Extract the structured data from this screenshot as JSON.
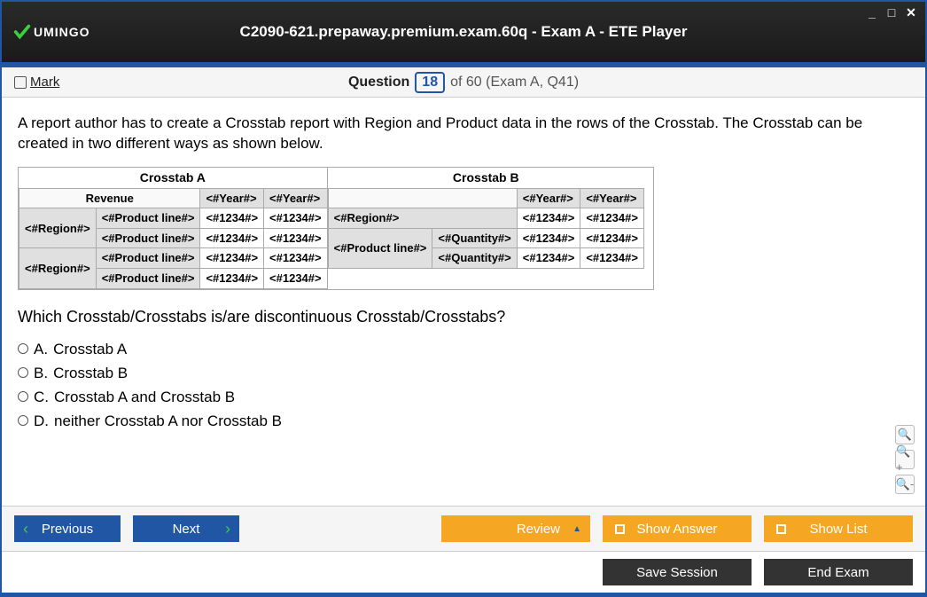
{
  "app": {
    "brand": "UMINGO",
    "title": "C2090-621.prepaway.premium.exam.60q - Exam A - ETE Player"
  },
  "qbar": {
    "mark": "Mark",
    "word": "Question",
    "num": "18",
    "of": "of 60 (Exam A, Q41)"
  },
  "question": {
    "text": "A report author has to create a Crosstab report with Region and Product data in the rows of the Crosstab. The Crosstab can be created in two different ways as shown below.",
    "subq": "Which Crosstab/Crosstabs is/are discontinuous Crosstab/Crosstabs?"
  },
  "crosstabA": {
    "title": "Crosstab A",
    "corner": "Revenue",
    "year": "<#Year#>",
    "region": "<#Region#>",
    "pline": "<#Product line#>",
    "val": "<#1234#>"
  },
  "crosstabB": {
    "title": "Crosstab B",
    "year": "<#Year#>",
    "region": "<#Region#>",
    "pline": "<#Product line#>",
    "qty": "<#Quantity#>",
    "val": "<#1234#>"
  },
  "options": [
    {
      "letter": "A.",
      "text": "Crosstab A"
    },
    {
      "letter": "B.",
      "text": "Crosstab B"
    },
    {
      "letter": "C.",
      "text": "Crosstab A and Crosstab B"
    },
    {
      "letter": "D.",
      "text": "neither Crosstab A nor Crosstab B"
    }
  ],
  "buttons": {
    "prev": "Previous",
    "next": "Next",
    "review": "Review",
    "showAnswer": "Show Answer",
    "showList": "Show List",
    "save": "Save Session",
    "end": "End Exam"
  }
}
